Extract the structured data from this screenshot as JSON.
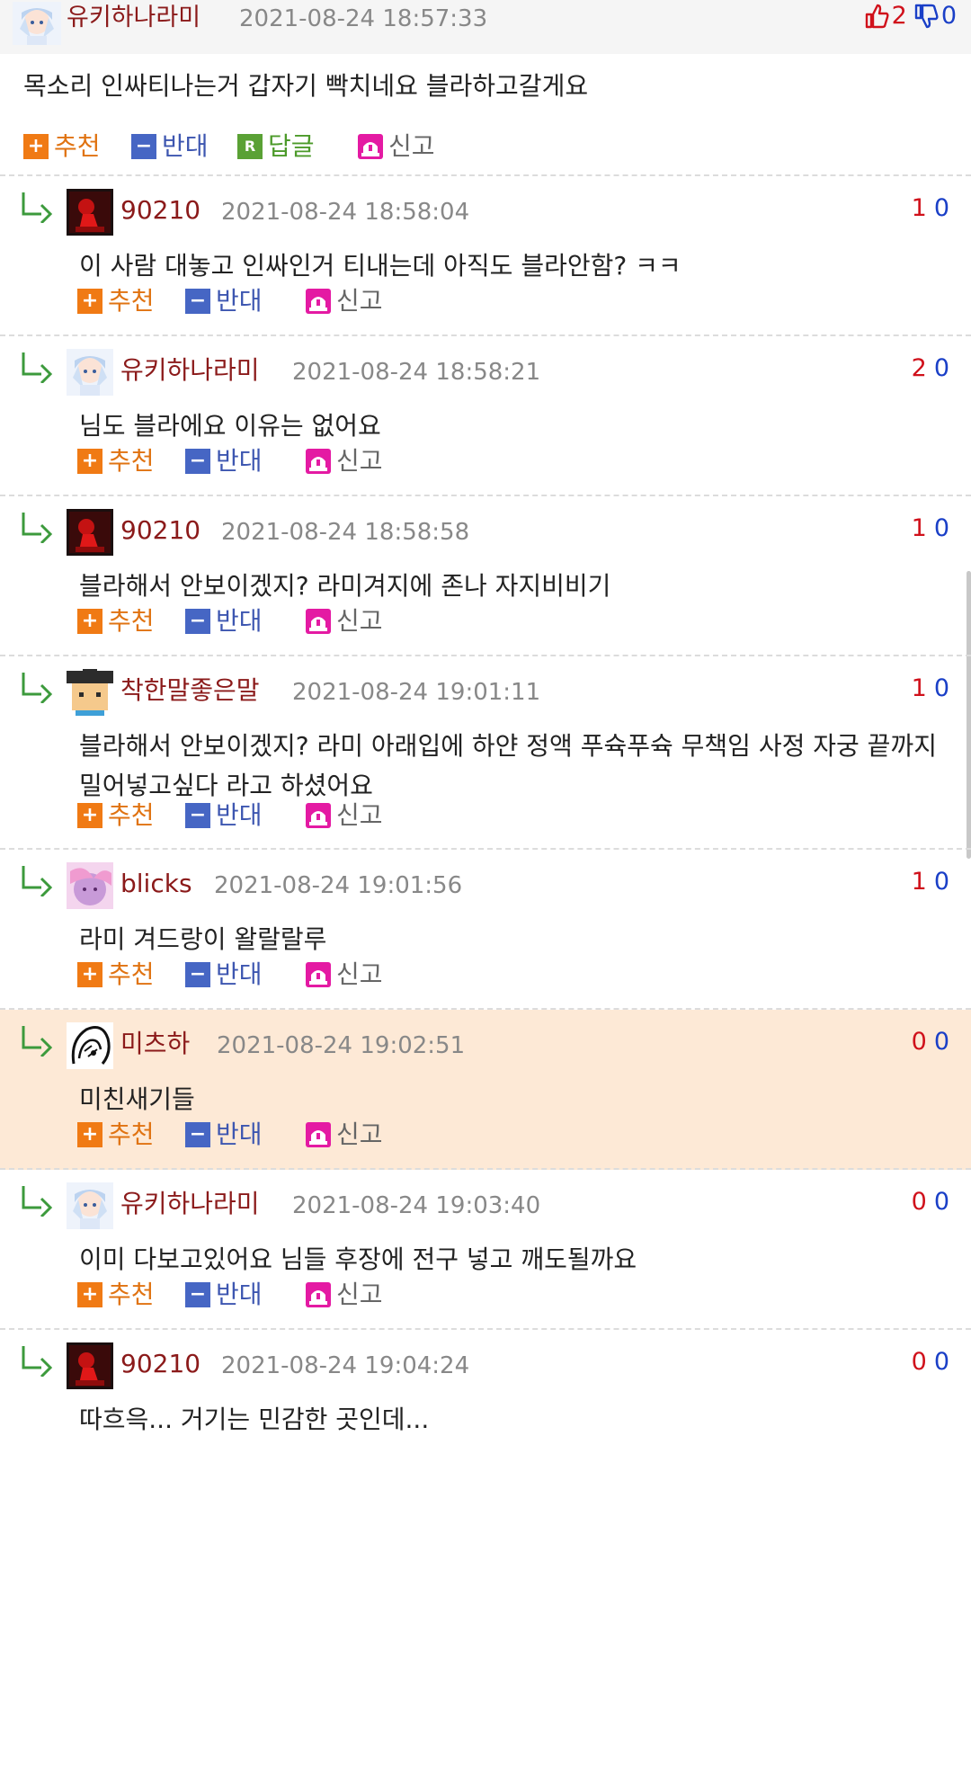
{
  "top_comment": {
    "nick": "유키하나라미",
    "date": "2021-08-24 18:57:33",
    "up": "2",
    "down": "0",
    "body": "목소리 인싸티나는거 갑자기 빡치네요 블라하고갈게요"
  },
  "actions": {
    "recommend": "추천",
    "oppose": "반대",
    "reply": "답글",
    "report": "신고",
    "reply_icon_letter": "R"
  },
  "replies": [
    {
      "nick": "90210",
      "date": "2021-08-24 18:58:04",
      "up": "1",
      "down": "0",
      "body": "이 사람 대놓고 인싸인거 티내는데 아직도 블라안함? ㅋㅋ",
      "avatar": "dark-red-avatar"
    },
    {
      "nick": "유키하나라미",
      "date": "2021-08-24 18:58:21",
      "up": "2",
      "down": "0",
      "body": "님도 블라에요 이유는 없어요",
      "avatar": "anime-avatar"
    },
    {
      "nick": "90210",
      "date": "2021-08-24 18:58:58",
      "up": "1",
      "down": "0",
      "body": "블라해서 안보이겠지? 라미겨지에 존나 자지비비기",
      "avatar": "dark-red-avatar"
    },
    {
      "nick": "착한말좋은말",
      "date": "2021-08-24 19:01:11",
      "up": "1",
      "down": "0",
      "body": "블라해서 안보이겠지? 라미 아래입에 하얀 정액 푸슉푸슉 무책임 사정 자궁 끝까지 밀어넣고싶다 라고 하셨어요",
      "avatar": "pixel-avatar"
    },
    {
      "nick": "blicks",
      "date": "2021-08-24 19:01:56",
      "up": "1",
      "down": "0",
      "body": "라미 겨드랑이 왈랄랄루",
      "avatar": "pink-avatar"
    },
    {
      "nick": "미츠하",
      "date": "2021-08-24 19:02:51",
      "up": "0",
      "down": "0",
      "body": "미친새기들",
      "avatar": "sketch-avatar",
      "highlighted": true
    },
    {
      "nick": "유키하나라미",
      "date": "2021-08-24 19:03:40",
      "up": "0",
      "down": "0",
      "body": "이미 다보고있어요 님들 후장에 전구 넣고 깨도될까요",
      "avatar": "anime-avatar"
    },
    {
      "nick": "90210",
      "date": "2021-08-24 19:04:24",
      "up": "0",
      "down": "0",
      "body": "따흐윽... 거기는 민감한 곳인데...",
      "avatar": "dark-red-avatar"
    }
  ]
}
